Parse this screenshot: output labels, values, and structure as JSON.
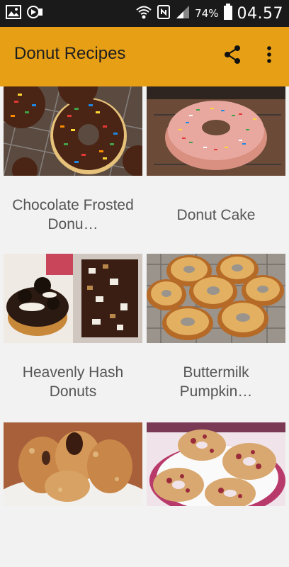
{
  "status_bar": {
    "battery_percent": "74%",
    "time": "04.57"
  },
  "app_bar": {
    "title": "Donut Recipes",
    "share_icon": "share-icon",
    "more_icon": "more-vert-icon"
  },
  "recipes": [
    {
      "title": "Chocolate Frosted Donu…"
    },
    {
      "title": "Donut Cake"
    },
    {
      "title": "Heavenly Hash Donuts"
    },
    {
      "title": "Buttermilk Pumpkin…"
    },
    {
      "title": ""
    },
    {
      "title": ""
    }
  ],
  "colors": {
    "app_bar": "#e7a016",
    "status_bar": "#1a1a1a",
    "background": "#f2f2f2",
    "label_text": "#555555"
  }
}
